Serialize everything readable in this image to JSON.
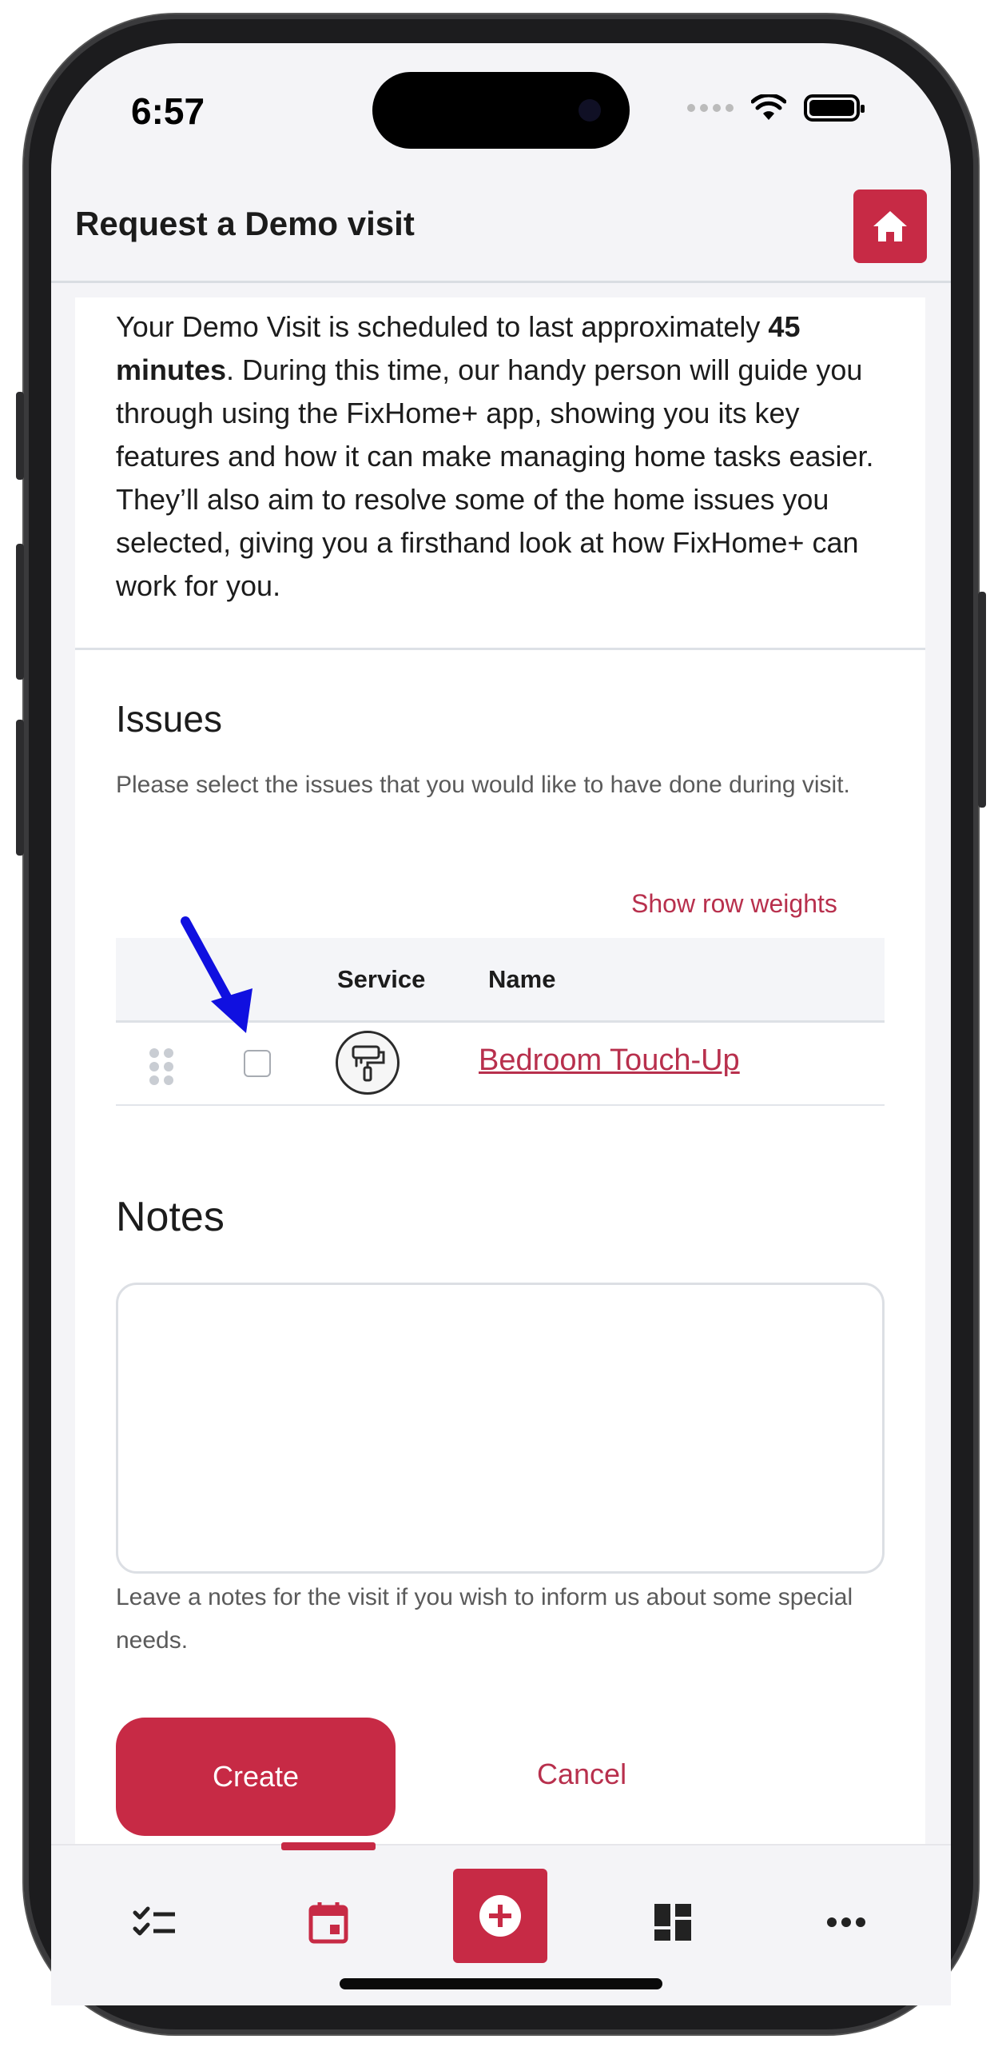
{
  "status_bar": {
    "time": "6:57"
  },
  "header": {
    "title": "Request a Demo visit"
  },
  "intro": {
    "text_1": "Your Demo Visit is scheduled to last approximately ",
    "duration": "45 minutes",
    "text_2": ". During this time, our handy person will guide you through using the FixHome+ app, showing you its key features and how it can make managing home tasks easier. They’ll also aim to resolve some of the home issues you selected, giving you a firsthand look at how FixHome+ can work for you."
  },
  "issues": {
    "title": "Issues",
    "helper": "Please select the issues that you would like to have done during visit.",
    "show_row_weights": "Show row weights",
    "columns": {
      "service": "Service",
      "name": "Name"
    },
    "rows": [
      {
        "name": "Bedroom Touch-Up",
        "selected": false
      }
    ]
  },
  "notes": {
    "title": "Notes",
    "value": "",
    "helper": "Leave a notes for the visit if you wish to inform us about some special needs."
  },
  "actions": {
    "create": "Create",
    "cancel": "Cancel"
  },
  "colors": {
    "accent": "#c72a45",
    "link": "#b8304d"
  },
  "bottom_nav": {
    "items": [
      "tasks-icon",
      "calendar-icon",
      "add-icon",
      "dashboard-icon",
      "more-icon"
    ],
    "active": "calendar-icon"
  }
}
